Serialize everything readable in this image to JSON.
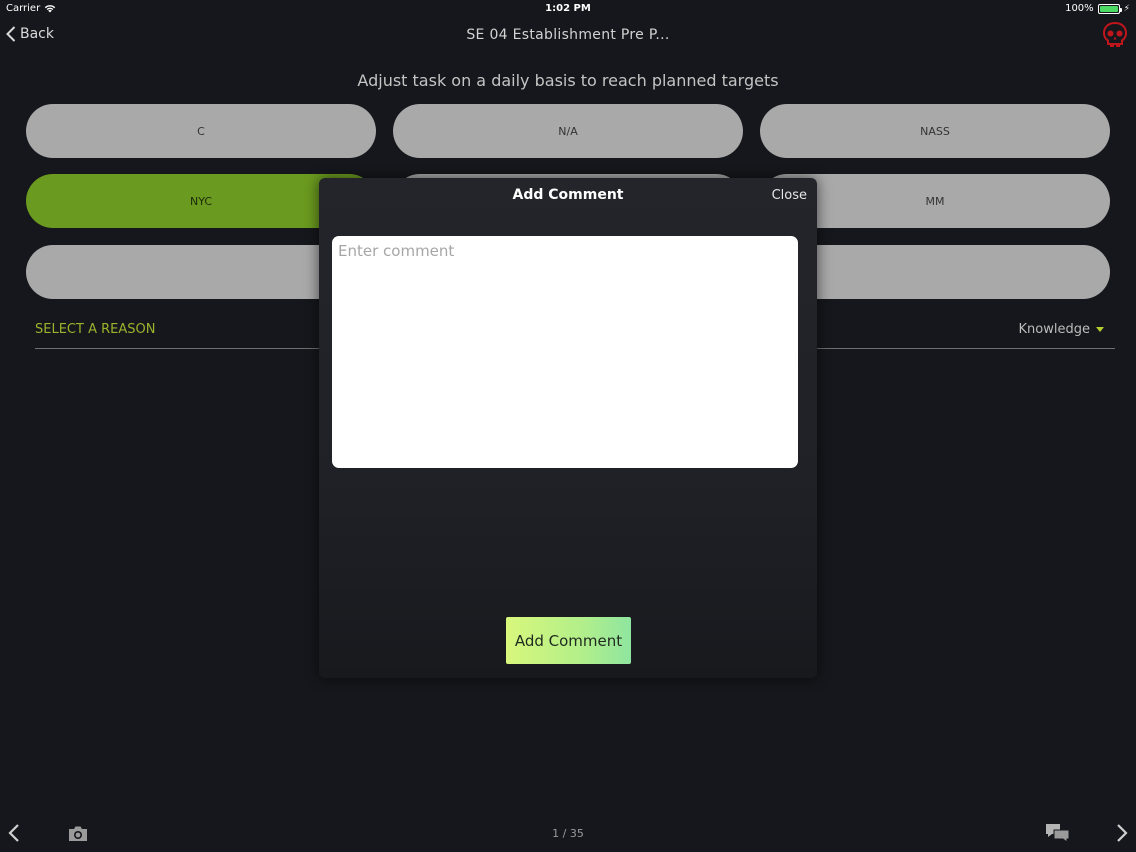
{
  "status_bar": {
    "carrier": "Carrier",
    "time": "1:02 PM",
    "battery": "100%",
    "battery_level": 1.0
  },
  "nav": {
    "back_label": "Back",
    "title": "SE 04 Establishment Pre P...",
    "alert_icon": "skull-icon",
    "alert_color": "#c0151b"
  },
  "subtitle": "Adjust task on a daily basis to reach planned targets",
  "options": {
    "row1": [
      "C",
      "N/A",
      "NASS"
    ],
    "row2": [
      "NYC",
      "",
      "MM"
    ],
    "row3": [
      "",
      "",
      ""
    ],
    "selected": "NYC",
    "selected_color": "#6a9a1f"
  },
  "reason": {
    "label": "SELECT A REASON",
    "value": "Knowledge"
  },
  "bottom_bar": {
    "page": "1 / 35",
    "icons": [
      "chevron-left-icon",
      "camera-icon",
      "chat-icon",
      "chevron-right-icon"
    ]
  },
  "modal": {
    "title": "Add Comment",
    "close_label": "Close",
    "comment_placeholder": "Enter comment",
    "comment_value": "",
    "submit_label": "Add Comment"
  }
}
